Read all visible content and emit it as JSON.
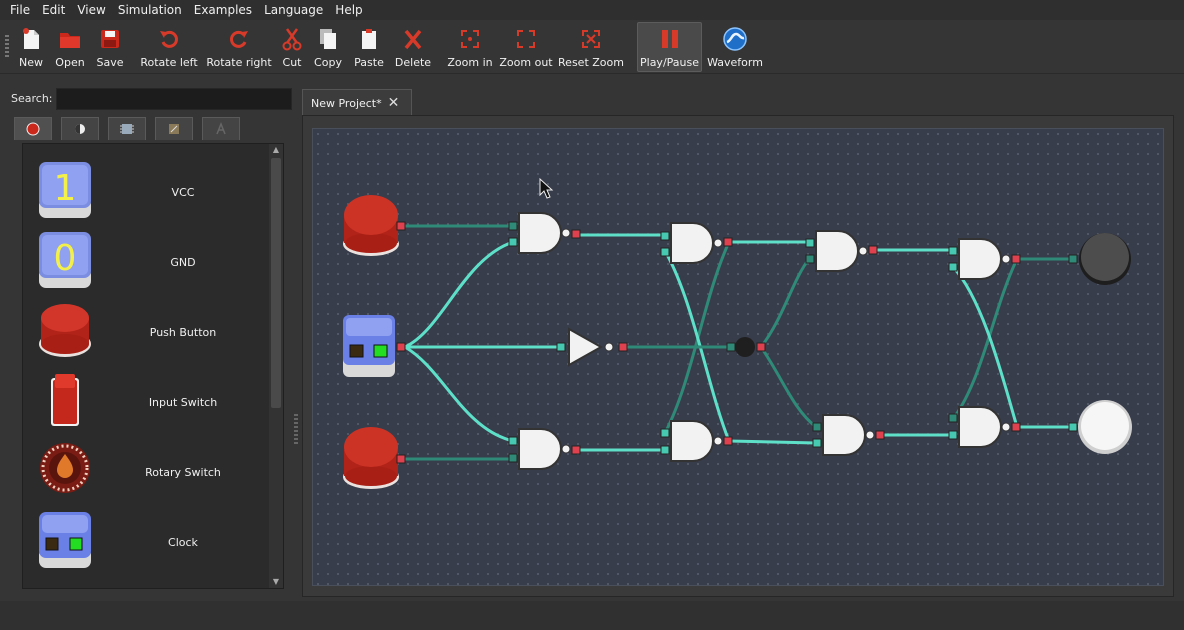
{
  "menu": [
    "File",
    "Edit",
    "View",
    "Simulation",
    "Examples",
    "Language",
    "Help"
  ],
  "toolbar": {
    "new": "New",
    "open": "Open",
    "save": "Save",
    "rotate_left": "Rotate left",
    "rotate_right": "Rotate right",
    "cut": "Cut",
    "copy": "Copy",
    "paste": "Paste",
    "delete": "Delete",
    "zoom_in": "Zoom in",
    "zoom_out": "Zoom out",
    "reset_zoom": "Reset Zoom",
    "play_pause": "Play/Pause",
    "waveform": "Waveform"
  },
  "search": {
    "label": "Search:",
    "value": ""
  },
  "palette": {
    "items": [
      {
        "label": "VCC",
        "icon": "vcc-icon"
      },
      {
        "label": "GND",
        "icon": "gnd-icon"
      },
      {
        "label": "Push Button",
        "icon": "push-button-icon"
      },
      {
        "label": "Input Switch",
        "icon": "input-switch-icon"
      },
      {
        "label": "Rotary Switch",
        "icon": "rotary-switch-icon"
      },
      {
        "label": "Clock",
        "icon": "clock-icon"
      }
    ],
    "vcc_digit": "1",
    "gnd_digit": "0"
  },
  "document_tab": {
    "title": "New Project*"
  },
  "colors": {
    "wire_active": "#5ee0c8",
    "wire_inactive": "#2f8a78",
    "port_in": "#46c9b0",
    "port_out": "#e0414f",
    "led_off": "#4a4a4a",
    "led_on": "#f4f4f4",
    "button": "#c0281a"
  }
}
